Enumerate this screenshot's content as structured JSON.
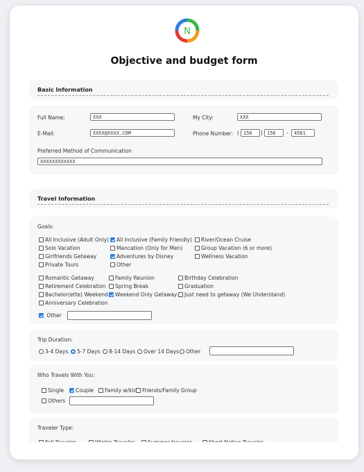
{
  "form": {
    "title": "Objective and budget form"
  },
  "basic": {
    "title": "Basic Information",
    "full_name": {
      "label": "Full Name:",
      "value": "XXX"
    },
    "city": {
      "label": "My City:",
      "value": "XXX"
    },
    "email": {
      "label": "E-Mail:",
      "value": "XXXX@XXXX.COM"
    },
    "phone": {
      "label": "Phone Number:",
      "p1": "156",
      "p2": "156",
      "p3": "4561",
      "open": "(",
      "close": ")",
      "dash": "-"
    },
    "comm": {
      "label": "Preferred Method of Communication",
      "value": "XXXXXXXXXXXX"
    }
  },
  "travel": {
    "title": "Travel Information",
    "goals": {
      "label": "Goals:",
      "options": [
        {
          "label": "All Inclusive (Adult Only)",
          "checked": false
        },
        {
          "label": "All Inclusive (Family Friendly)",
          "checked": true
        },
        {
          "label": "River/Ocean Cruise",
          "checked": false
        },
        {
          "label": "Solo Vacation",
          "checked": false
        },
        {
          "label": "Mancation (Only for Men)",
          "checked": false
        },
        {
          "label": "Group Vacation (6 or more)",
          "checked": false
        },
        {
          "label": "Girlfriends Getaway",
          "checked": false
        },
        {
          "label": "Adventures by Disney",
          "checked": true
        },
        {
          "label": "Wellness Vacation",
          "checked": false
        },
        {
          "label": "Private Tours",
          "checked": false
        },
        {
          "label": "Other",
          "checked": false
        },
        {
          "label": "Romantic Getaway",
          "checked": false
        },
        {
          "label": "Family Reunion",
          "checked": false
        },
        {
          "label": "Birthday Celebration",
          "checked": false
        },
        {
          "label": "Retirement Celebration",
          "checked": false
        },
        {
          "label": "Spring Break",
          "checked": false
        },
        {
          "label": "Graduation",
          "checked": false
        },
        {
          "label": "Bachelor(ette) Weekend",
          "checked": false
        },
        {
          "label": "Weekend Only Getaway",
          "checked": true
        },
        {
          "label": "Just need to getaway (We Understand)",
          "checked": false
        },
        {
          "label": "Anniversary Celebration",
          "checked": false
        }
      ],
      "other": {
        "label": "Other",
        "checked": true,
        "value": ""
      }
    }
  },
  "trip": {
    "label": "Trip Duration:",
    "options": [
      {
        "label": "3-4 Days",
        "selected": false
      },
      {
        "label": "5-7 Days",
        "selected": true
      },
      {
        "label": "8-14 Days",
        "selected": false
      },
      {
        "label": "Over 14 Days",
        "selected": false
      },
      {
        "label": "Other",
        "selected": false
      }
    ],
    "other_value": ""
  },
  "who": {
    "label": "Who Travels With You:",
    "options": [
      {
        "label": "Single",
        "checked": false
      },
      {
        "label": "Couple",
        "checked": true
      },
      {
        "label": "Family w/kids",
        "checked": false
      },
      {
        "label": "Friends/Family Group",
        "checked": false
      }
    ],
    "others": {
      "label": "Others",
      "checked": false,
      "value": ""
    }
  },
  "traveler_type": {
    "label": "Traveler Type:",
    "options": [
      "Fall Traveler",
      "Winter Traveler",
      "Summer traveler",
      "Short Notice Traveler"
    ]
  },
  "colors": {
    "accent": "#2f7de1",
    "logo_green": "#3bb54a",
    "logo_orange": "#f29a1f",
    "logo_red": "#e53935",
    "logo_blue": "#2f7de1"
  }
}
